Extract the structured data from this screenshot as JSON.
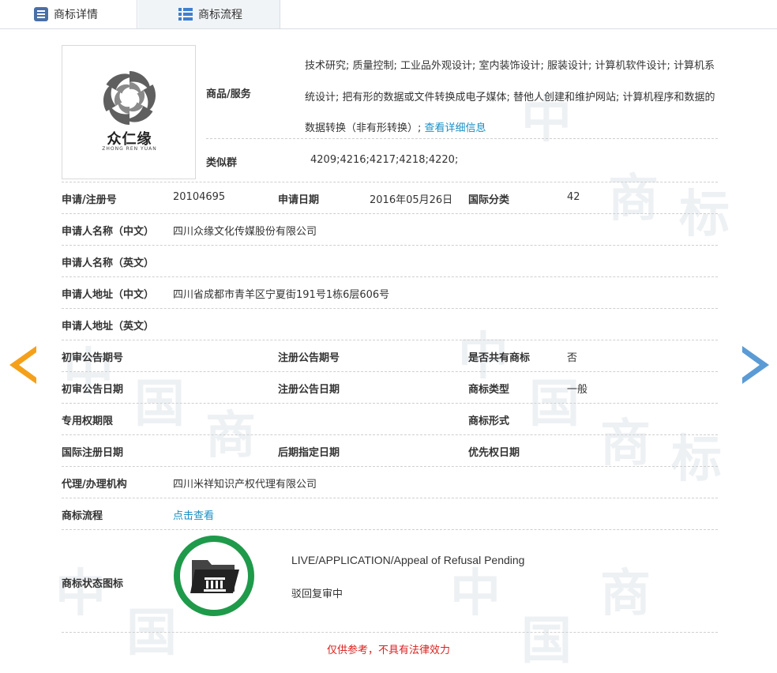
{
  "tabs": [
    {
      "label": "商标详情",
      "icon": "document-icon",
      "active": true
    },
    {
      "label": "商标流程",
      "icon": "list-icon",
      "active": false
    }
  ],
  "logo": {
    "cn_text": "众仁缘",
    "en_text": "ZHONG REN YUAN"
  },
  "goods": {
    "label": "商品/服务",
    "text": "技术研究; 质量控制; 工业品外观设计; 室内装饰设计; 服装设计; 计算机软件设计; 计算机系统设计; 把有形的数据或文件转换成电子媒体; 替他人创建和维护网站; 计算机程序和数据的数据转换（非有形转换）;",
    "more_link": "查看详细信息"
  },
  "similar_group": {
    "label": "类似群",
    "value": "4209;4216;4217;4218;4220;"
  },
  "fields": {
    "reg_no": {
      "label": "申请/注册号",
      "value": "20104695"
    },
    "apply_date": {
      "label": "申请日期",
      "value": "2016年05月26日"
    },
    "intl_class": {
      "label": "国际分类",
      "value": "42"
    },
    "applicant_cn": {
      "label": "申请人名称（中文）",
      "value": "四川众缘文化传媒股份有限公司"
    },
    "applicant_en": {
      "label": "申请人名称（英文）",
      "value": ""
    },
    "address_cn": {
      "label": "申请人地址（中文）",
      "value": "四川省成都市青羊区宁夏街191号1栋6层606号"
    },
    "address_en": {
      "label": "申请人地址（英文）",
      "value": ""
    },
    "prelim_issue": {
      "label": "初审公告期号",
      "value": ""
    },
    "reg_issue": {
      "label": "注册公告期号",
      "value": ""
    },
    "shared": {
      "label": "是否共有商标",
      "value": "否"
    },
    "prelim_date": {
      "label": "初审公告日期",
      "value": ""
    },
    "reg_date": {
      "label": "注册公告日期",
      "value": ""
    },
    "tm_type": {
      "label": "商标类型",
      "value": "一般"
    },
    "exclusive_period": {
      "label": "专用权期限",
      "value": ""
    },
    "tm_form": {
      "label": "商标形式",
      "value": ""
    },
    "intl_reg_date": {
      "label": "国际注册日期",
      "value": ""
    },
    "later_date": {
      "label": "后期指定日期",
      "value": ""
    },
    "priority_date": {
      "label": "优先权日期",
      "value": ""
    },
    "agent": {
      "label": "代理/办理机构",
      "value": "四川米祥知识产权代理有限公司"
    },
    "process": {
      "label": "商标流程",
      "value": "点击查看"
    }
  },
  "status": {
    "label": "商标状态图标",
    "en": "LIVE/APPLICATION/Appeal of Refusal Pending",
    "cn": "驳回复审中",
    "ring_color": "#1e9a4a"
  },
  "notice": "仅供参考，不具有法律效力",
  "colors": {
    "link": "#1a8fc4",
    "arrow_left": "#f5a01a",
    "arrow_right": "#5b9bd5",
    "notice": "#d9211e"
  },
  "watermark_chars": [
    "中",
    "国",
    "商",
    "标"
  ]
}
